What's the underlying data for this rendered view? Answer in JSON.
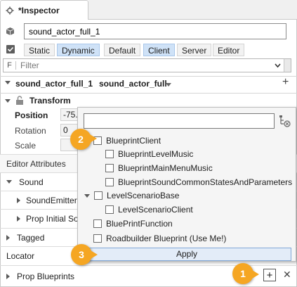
{
  "tab": {
    "title": "*Inspector"
  },
  "actor": {
    "name_value": "sound_actor_full_1"
  },
  "filters": [
    "Static",
    "Dynamic",
    "Default",
    "Client",
    "Server",
    "Editor"
  ],
  "search": {
    "prefix": "F",
    "placeholder": "Filter"
  },
  "entity": {
    "name": "sound_actor_full_1",
    "type": "sound_actor_full"
  },
  "transform": {
    "title": "Transform",
    "position_label": "Position",
    "position_value": "-75.",
    "rotation_label": "Rotation",
    "rotation_value": "0",
    "scale_label": "Scale"
  },
  "sections": {
    "editor_attributes": "Editor Attributes",
    "sound": "Sound",
    "sound_emitter": "SoundEmitter",
    "prop_initial": "Prop Initial So",
    "tagged": "Tagged",
    "locator": "Locator",
    "prop_blueprints": "Prop Blueprints"
  },
  "popup": {
    "items": [
      {
        "label": "BlueprintClient"
      },
      {
        "label": "BlueprintLevelMusic"
      },
      {
        "label": "BlueprintMainMenuMusic"
      },
      {
        "label": "BlueprintSoundCommonStatesAndParameters"
      },
      {
        "label": "LevelScenarioBase"
      },
      {
        "label": "LevelScenarioClient"
      },
      {
        "label": "BluePrintFunction"
      },
      {
        "label": "Roadbuilder Blueprint (Use Me!)"
      }
    ],
    "apply": "Apply"
  },
  "badges": [
    "1",
    "2",
    "3"
  ],
  "colors": {
    "accent_chip": "#cfe2f7",
    "badge": "#f5a623"
  }
}
